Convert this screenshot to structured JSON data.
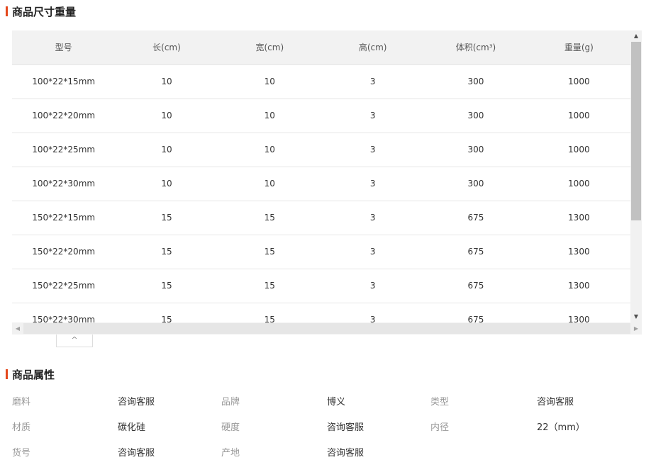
{
  "size_section": {
    "title": "商品尺寸重量"
  },
  "table": {
    "headers": [
      "型号",
      "长(cm)",
      "宽(cm)",
      "高(cm)",
      "体积(cm³)",
      "重量(g)"
    ],
    "rows": [
      [
        "100*22*15mm",
        "10",
        "10",
        "3",
        "300",
        "1000"
      ],
      [
        "100*22*20mm",
        "10",
        "10",
        "3",
        "300",
        "1000"
      ],
      [
        "100*22*25mm",
        "10",
        "10",
        "3",
        "300",
        "1000"
      ],
      [
        "100*22*30mm",
        "10",
        "10",
        "3",
        "300",
        "1000"
      ],
      [
        "150*22*15mm",
        "15",
        "15",
        "3",
        "675",
        "1300"
      ],
      [
        "150*22*20mm",
        "15",
        "15",
        "3",
        "675",
        "1300"
      ],
      [
        "150*22*25mm",
        "15",
        "15",
        "3",
        "675",
        "1300"
      ],
      [
        "150*22*30mm",
        "15",
        "15",
        "3",
        "675",
        "1300"
      ]
    ]
  },
  "scroll": {
    "up_icon": "▲",
    "down_icon": "▼",
    "left_icon": "◀",
    "right_icon": "▶"
  },
  "collapse": {
    "icon": "^"
  },
  "attr_section": {
    "title": "商品属性",
    "items": [
      {
        "label": "磨料",
        "value": "咨询客服"
      },
      {
        "label": "品牌",
        "value": "博义"
      },
      {
        "label": "类型",
        "value": "咨询客服"
      },
      {
        "label": "材质",
        "value": "碳化硅"
      },
      {
        "label": "硬度",
        "value": "咨询客服"
      },
      {
        "label": "内径",
        "value": "22（mm）"
      },
      {
        "label": "货号",
        "value": "咨询客服"
      },
      {
        "label": "产地",
        "value": "咨询客服"
      }
    ]
  }
}
